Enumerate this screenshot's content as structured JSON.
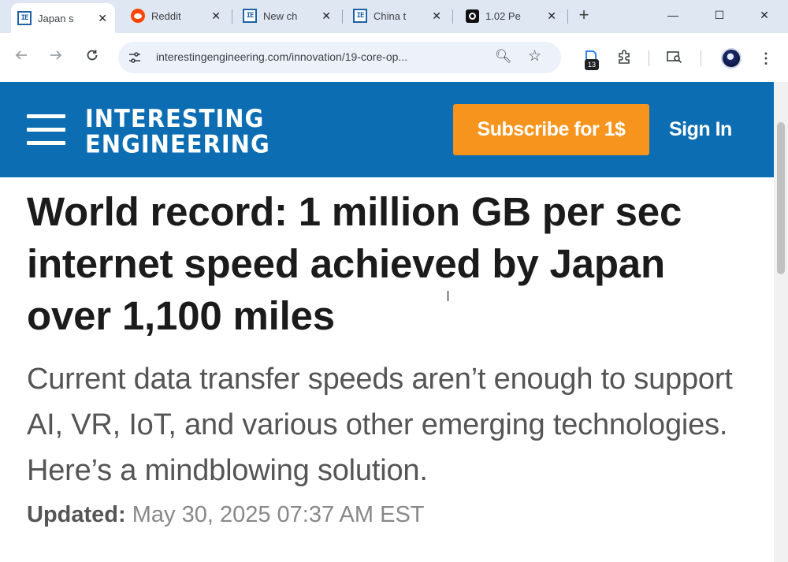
{
  "browser": {
    "tabs": [
      {
        "title": "Japan s",
        "icon": "ie-favicon",
        "active": true
      },
      {
        "title": "Reddit",
        "icon": "reddit-favicon",
        "active": false
      },
      {
        "title": "New ch",
        "icon": "ie-favicon",
        "active": false
      },
      {
        "title": "China t",
        "icon": "ie-favicon",
        "active": false
      },
      {
        "title": "1.02 Pe",
        "icon": "dark-favicon",
        "active": false
      }
    ],
    "new_tab": "+",
    "url": "interestingengineering.com/innovation/19-core-op...",
    "extension_badge": "13"
  },
  "site": {
    "logo_line1": "INTERESTING",
    "logo_line2": "ENGINEERING",
    "subscribe_label": "Subscribe for 1$",
    "signin_label": "Sign In",
    "brand_color": "#0c6db3",
    "accent_color": "#f7941d"
  },
  "article": {
    "headline": "World record: 1 million GB per sec internet speed achieved by Japan over 1,100 miles",
    "subheadline": "Current data transfer speeds aren’t enough to support AI, VR, IoT, and various other emerging technologies. Here’s a mindblowing solution.",
    "updated_label": "Updated:",
    "updated_value": "May 30, 2025 07:37 AM EST"
  }
}
